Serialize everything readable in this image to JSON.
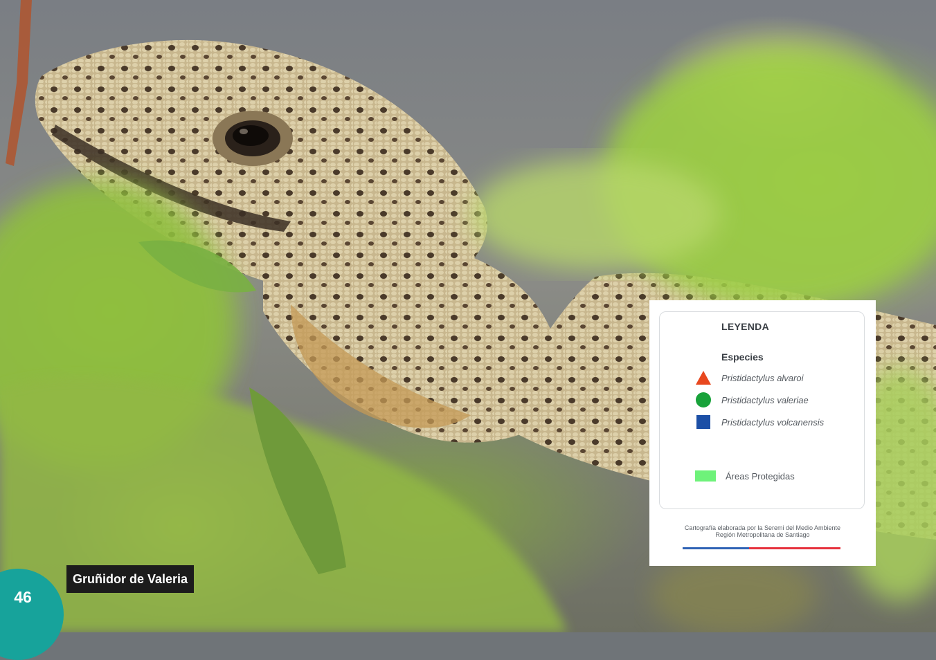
{
  "photo": {
    "subject": "lizard-among-leaves"
  },
  "legend": {
    "title": "LEYENDA",
    "species_heading": "Especies",
    "species": [
      {
        "label": "Pristidactylus alvaroi",
        "symbol": "triangle",
        "color": "#e8481f"
      },
      {
        "label": "Pristidactylus valeriae",
        "symbol": "circle",
        "color": "#18a23a"
      },
      {
        "label": "Pristidactylus volcanensis",
        "symbol": "square",
        "color": "#1c4fa6"
      }
    ],
    "protected_areas": {
      "label": "Áreas Protegidas",
      "color": "#6ef27a"
    },
    "credit_line1": "Cartografía elaborada por la Seremi del Medio Ambiente",
    "credit_line2": "Región Metropolitana de Santiago"
  },
  "caption": "Gruñidor de Valeria",
  "page_number": "46",
  "colors": {
    "page_tab": "#17a39b",
    "caption_bg": "#1c1c1c"
  }
}
